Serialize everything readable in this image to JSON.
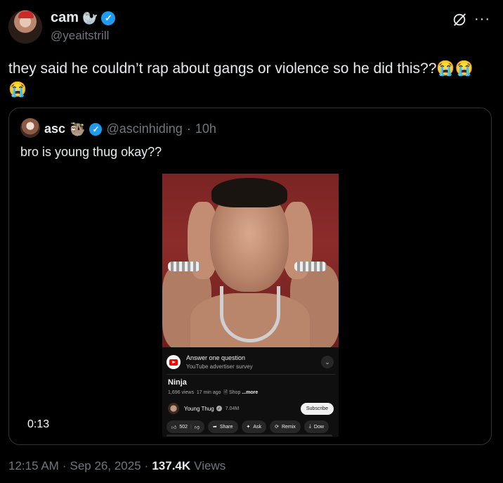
{
  "tweet": {
    "display_name": "cam",
    "name_emoji": "🦭",
    "verified_mark": "✓",
    "handle": "@yeaitstrill",
    "text": "they said he couldn’t rap about gangs or violence so he did this??😭😭😭",
    "more_label": "···"
  },
  "quote": {
    "display_name": "asc",
    "name_emoji": "🦥",
    "verified_mark": "✓",
    "handle": "@ascinhiding",
    "sep": "·",
    "time": "10h",
    "text": "bro is young thug okay??",
    "video_timer": "0:13"
  },
  "youtube": {
    "ad_title": "Answer one question",
    "ad_subtitle": "YouTube advertiser survey",
    "video_title": "Ninja",
    "views": "1,696 views",
    "ago": "17 min ago",
    "shop": "Shop",
    "more": "...more",
    "channel_name": "Young Thug",
    "channel_subs": "7.04M",
    "subscribe": "Subscribe",
    "likes": "502",
    "share": "Share",
    "ask": "Ask",
    "remix": "Remix",
    "download": "Dow"
  },
  "footer": {
    "time": "12:15 AM",
    "sep1": "·",
    "date": "Sep 26, 2025",
    "sep2": "·",
    "views_count": "137.4K",
    "views_label": "Views"
  },
  "colors": {
    "background": "#000000",
    "verified_blue": "#1d9bf0",
    "secondary_text": "#71767b",
    "primary_text": "#e7e9ea"
  }
}
